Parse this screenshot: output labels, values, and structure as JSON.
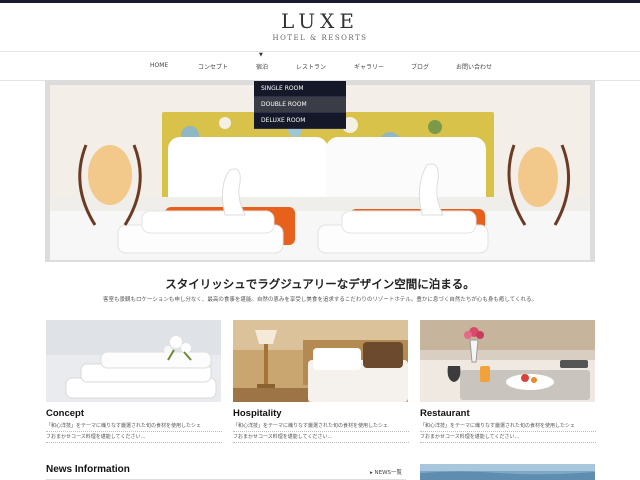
{
  "logo": {
    "title": "LUXE",
    "subtitle": "HOTEL & RESORTS"
  },
  "nav": {
    "items": [
      "HOME",
      "コンセプト",
      "宿泊",
      "レストラン",
      "ギャラリー",
      "ブログ",
      "お問い合わせ"
    ],
    "caret": "▼"
  },
  "dropdown": {
    "items": [
      "SINGLE ROOM",
      "DOUBLE ROOM",
      "DELUXE ROOM"
    ],
    "active_index": 1
  },
  "tagline": "スタイリッシュでラグジュアリーなデザイン空間に泊まる。",
  "intro": "客室も景観もロケーションも申し分なく、最高の食事を堪能。自然の恵みを享受し美食を追求するこだわりのリゾートホテル。豊かに息づく自然たちが心も身も癒してくれる。",
  "cards": [
    {
      "title": "Concept",
      "line1": "「和心洋技」をテーマに織りなす厳選された旬の食材を使用したシェ",
      "line2": "フおまかせコース料理を堪能してください…"
    },
    {
      "title": "Hospitality",
      "line1": "「和心洋技」をテーマに織りなす厳選された旬の食材を使用したシェ",
      "line2": "フおまかせコース料理を堪能してください…"
    },
    {
      "title": "Restaurant",
      "line1": "「和心洋技」をテーマに織りなす厳選された旬の食材を使用したシェ",
      "line2": "フおまかせコース料理を堪能してください…"
    }
  ],
  "news": {
    "title": "News Information",
    "link": "▸ NEWS一覧"
  },
  "colors": {
    "dark": "#151828",
    "accent_orange": "#e8611c",
    "headboard_yellow": "#d9c24a"
  }
}
